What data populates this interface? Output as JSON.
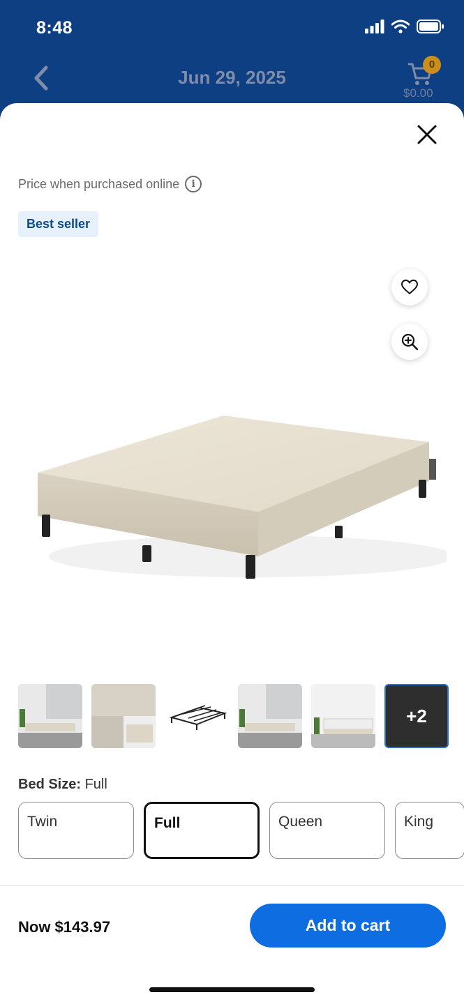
{
  "status_bar": {
    "time": "8:48"
  },
  "header": {
    "date": "Jun 29, 2025",
    "cart_count": "0",
    "cart_total": "$0.00"
  },
  "product": {
    "price_note": "Price when purchased online",
    "badge": "Best seller",
    "thumb_more": "+2",
    "size_label_key": "Bed Size:",
    "size_label_value": " Full",
    "sizes": [
      "Twin",
      "Full",
      "Queen",
      "King"
    ],
    "selected_size": "Full"
  },
  "footer": {
    "now_price": "Now $143.97",
    "add_to_cart": "Add to cart"
  },
  "icons": [
    "chevron-left-icon",
    "cart-icon",
    "close-icon",
    "info-icon",
    "heart-icon",
    "zoom-in-icon",
    "signal-icon",
    "wifi-icon",
    "battery-icon"
  ],
  "colors": {
    "header_bg": "#0f3f83",
    "primary_button": "#0e6de0",
    "badge_bg": "#e6f1fc",
    "badge_text": "#0c4a8c",
    "cart_badge": "#c98e1c"
  }
}
